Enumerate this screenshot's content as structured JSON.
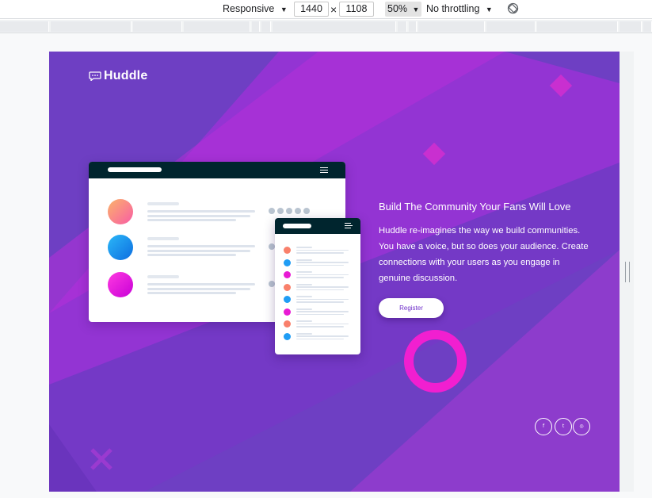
{
  "devtools": {
    "device": "Responsive",
    "width": "1440",
    "times": "×",
    "height": "1108",
    "zoom": "50%",
    "throttling": "No throttling",
    "dropdown_arrow": "▼",
    "rotate_icon": "rotate-icon"
  },
  "site": {
    "logo_text": "Huddle",
    "logo_icon": "chat-bubble-icon",
    "headline": "Build The Community Your Fans Will Love",
    "description": "Huddle re-imagines the way we build communities. You have a voice, but so does your audience. Create connections with your users as you engage in genuine discussion.",
    "register_label": "Register",
    "social": [
      {
        "icon": "facebook-icon",
        "glyph": "f"
      },
      {
        "icon": "twitter-icon",
        "glyph": "t"
      },
      {
        "icon": "instagram-icon",
        "glyph": "◎"
      }
    ]
  },
  "colors": {
    "background": "#6e3fc3",
    "accent_magenta": "#c62ed8",
    "ring": "#f11fd0",
    "window_bar": "#00252e",
    "button_text": "#6e2ec9"
  },
  "mockup": {
    "avatar_colors": [
      "#f9a06b",
      "#1f9df5",
      "#f81ad4"
    ],
    "small_dot_colors": [
      "#f9806b",
      "#1f9df5",
      "#e81ad4",
      "#f9806b",
      "#1f9df5",
      "#e81ad4",
      "#f9806b",
      "#1f9df5"
    ]
  }
}
